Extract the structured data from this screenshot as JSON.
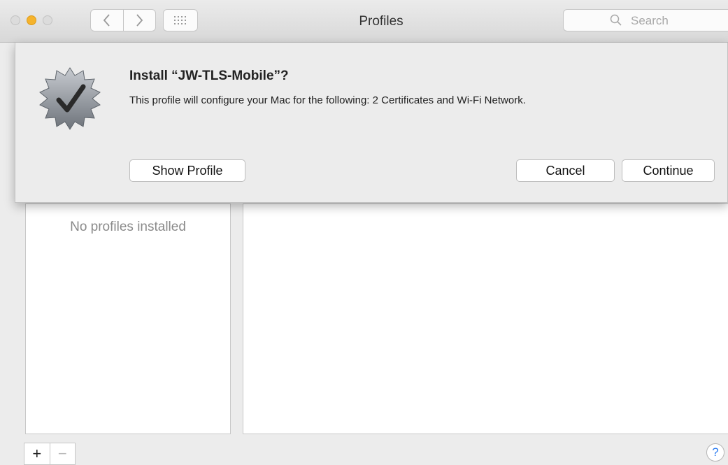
{
  "window": {
    "title": "Profiles",
    "accent_color": "#f5b32c"
  },
  "toolbar": {
    "back_icon": "chevron-left-icon",
    "forward_icon": "chevron-right-icon",
    "grid_icon": "show-all-grid-icon"
  },
  "search": {
    "placeholder": "Search",
    "icon": "magnifier-icon"
  },
  "sheet": {
    "title": "Install “JW-TLS-Mobile”?",
    "message": "This profile will configure your Mac for the following: 2 Certificates and Wi-Fi Network.",
    "badge_icon": "verified-checkmark-badge-icon",
    "buttons": {
      "show_profile": "Show Profile",
      "cancel": "Cancel",
      "continue": "Continue"
    }
  },
  "profiles_list": {
    "empty_text": "No profiles installed"
  },
  "bottom_bar": {
    "add_label": "+",
    "remove_label": "−",
    "help_label": "?"
  }
}
